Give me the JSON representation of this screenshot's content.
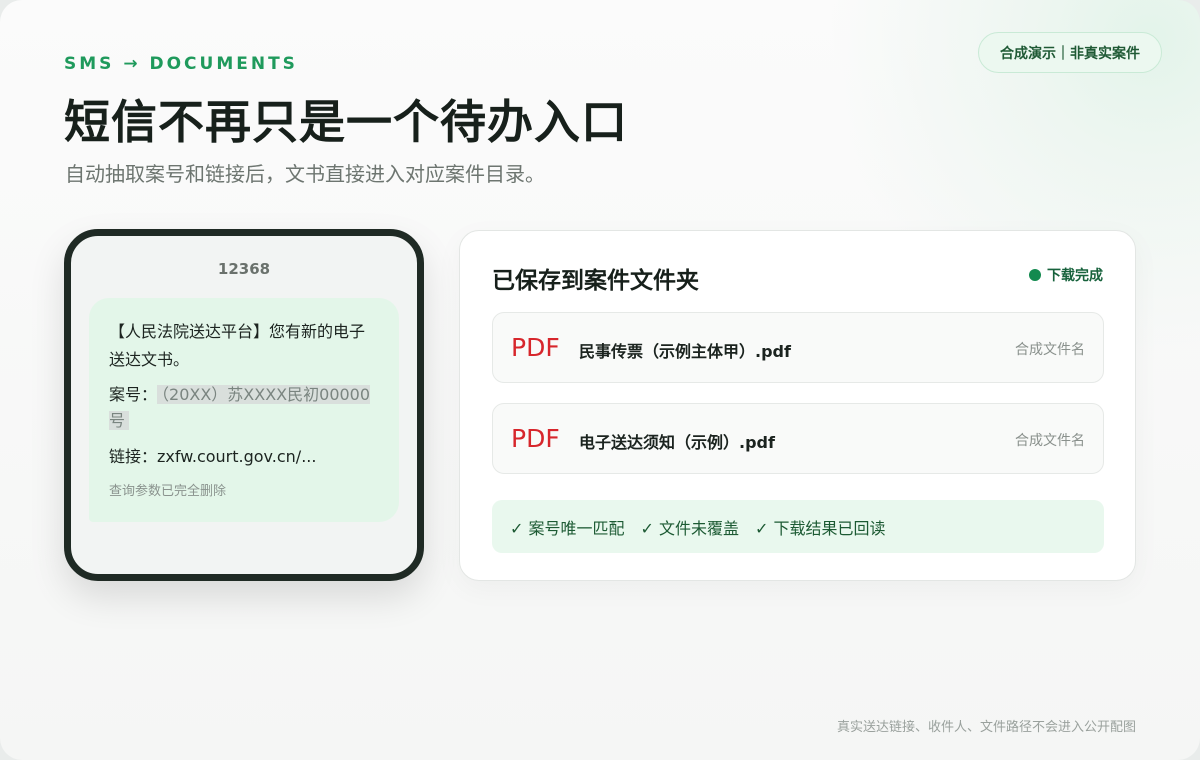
{
  "header": {
    "eyebrow": "SMS → DOCUMENTS",
    "badge": "合成演示｜非真实案件",
    "title": "短信不再只是一个待办入口",
    "subtitle": "自动抽取案号和链接后，文书直接进入对应案件目录。"
  },
  "phone": {
    "sender": "12368",
    "message_body": "【人民法院送达平台】您有新的电子送达文书。",
    "case_label": "案号：",
    "case_number": "（20XX）苏XXXX民初00000号",
    "link_label": "链接：",
    "link_value": "zxfw.court.gov.cn/...",
    "note": "查询参数已完全删除"
  },
  "panel": {
    "title": "已保存到案件文件夹",
    "status": "下载完成",
    "files": [
      {
        "icon": "PDF",
        "name": "民事传票（示例主体甲）.pdf",
        "meta": "合成文件名"
      },
      {
        "icon": "PDF",
        "name": "电子送达须知（示例）.pdf",
        "meta": "合成文件名"
      }
    ],
    "checks": [
      "✓ 案号唯一匹配",
      "✓ 文件未覆盖",
      "✓ 下载结果已回读"
    ]
  },
  "footer": "真实送达链接、收件人、文件路径不会进入公开配图",
  "colors": {
    "accent": "#1f9a5c",
    "pdf_red": "#d7262c",
    "bubble_bg": "#e3f6e9",
    "status_dot": "#138a4f"
  }
}
